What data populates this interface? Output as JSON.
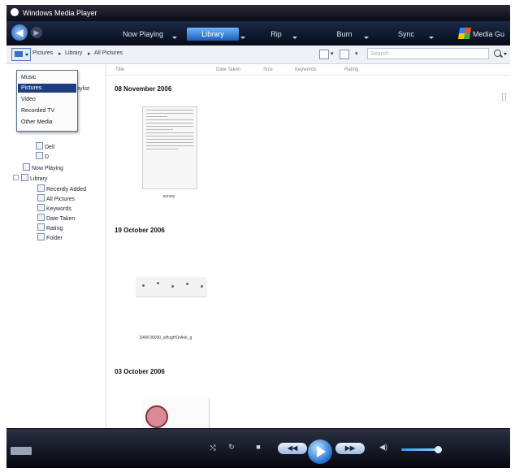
{
  "window": {
    "title": "Windows Media Player"
  },
  "nav": {
    "tabs": [
      {
        "label": "Now Playing",
        "active": false
      },
      {
        "label": "Library",
        "active": true
      },
      {
        "label": "Rip",
        "active": false
      },
      {
        "label": "Burn",
        "active": false
      },
      {
        "label": "Sync",
        "active": false
      },
      {
        "label": "Media Gu",
        "active": false
      }
    ]
  },
  "toolbar": {
    "breadcrumb": [
      "Pictures",
      "Library",
      "All Pictures"
    ],
    "search_placeholder": "Search"
  },
  "category_menu": {
    "items": [
      "Music",
      "Pictures",
      "Video",
      "Recorded TV",
      "Other Media"
    ],
    "selected": "Pictures"
  },
  "sidebar": {
    "playlists_label": "Playlist",
    "items": [
      "Dell",
      "D",
      "Now Playing",
      "Library",
      "Recently Added",
      "All Pictures",
      "Keywords",
      "Date Taken",
      "Rating",
      "Folder"
    ]
  },
  "columns": [
    "Title",
    "Date Taken",
    "Size",
    "Keywords",
    "Rating"
  ],
  "groups": [
    {
      "date": "08 November 2006",
      "items": [
        {
          "caption": "survey"
        }
      ]
    },
    {
      "date": "19 October 2006",
      "items": [
        {
          "caption": "DAM 06000_aHugHOrAnk_g"
        }
      ]
    },
    {
      "date": "03 October 2006",
      "items": []
    }
  ],
  "colors": {
    "nav_active": "#2d7de0",
    "menu_selected": "#1c3e7e",
    "background": "#ffffff"
  }
}
